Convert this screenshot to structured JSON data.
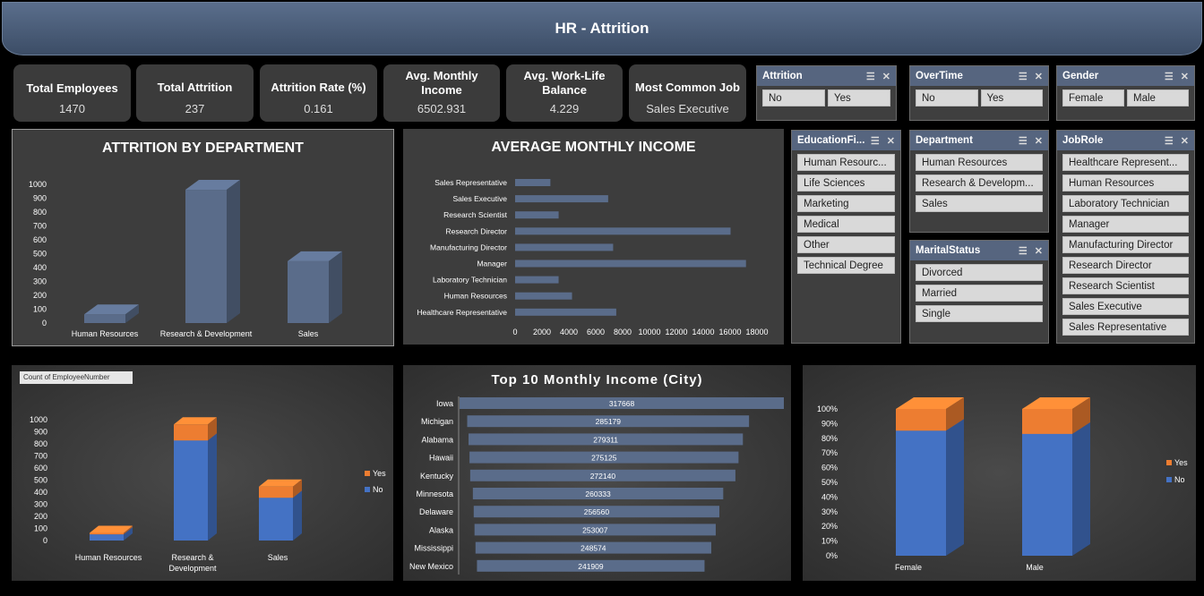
{
  "header": {
    "title": "HR - Attrition"
  },
  "kpis": [
    {
      "label": "Total Employees",
      "value": "1470"
    },
    {
      "label": "Total Attrition",
      "value": "237"
    },
    {
      "label": "Attrition Rate (%)",
      "value": "0.161"
    },
    {
      "label": "Avg. Monthly Income",
      "value": "6502.931"
    },
    {
      "label": "Avg. Work-Life Balance",
      "value": "4.229"
    },
    {
      "label": "Most Common Job",
      "value": "Sales Executive"
    }
  ],
  "slicers": {
    "attrition": {
      "title": "Attrition",
      "items": [
        "No",
        "Yes"
      ]
    },
    "overtime": {
      "title": "OverTime",
      "items": [
        "No",
        "Yes"
      ]
    },
    "gender": {
      "title": "Gender",
      "items": [
        "Female",
        "Male"
      ]
    },
    "education": {
      "title": "EducationFi...",
      "items": [
        "Human Resourc...",
        "Life Sciences",
        "Marketing",
        "Medical",
        "Other",
        "Technical Degree"
      ]
    },
    "department": {
      "title": "Department",
      "items": [
        "Human Resources",
        "Research & Developm...",
        "Sales"
      ]
    },
    "marital": {
      "title": "MaritalStatus",
      "items": [
        "Divorced",
        "Married",
        "Single"
      ]
    },
    "jobrole": {
      "title": "JobRole",
      "items": [
        "Healthcare Represent...",
        "Human Resources",
        "Laboratory Technician",
        "Manager",
        "Manufacturing Director",
        "Research Director",
        "Research Scientist",
        "Sales Executive",
        "Sales Representative"
      ]
    }
  },
  "chart_data": [
    {
      "type": "bar",
      "title": "ATTRITION BY DEPARTMENT",
      "categories": [
        "Human Resources",
        "Research & Development",
        "Sales"
      ],
      "values": [
        63,
        961,
        446
      ],
      "ylim": [
        0,
        1000
      ],
      "yticks": [
        "0",
        "100",
        "200",
        "300",
        "400",
        "500",
        "600",
        "700",
        "800",
        "900",
        "1000"
      ]
    },
    {
      "type": "bar",
      "title": "AVERAGE MONTHLY INCOME",
      "orientation": "horizontal",
      "categories": [
        "Sales Representative",
        "Sales Executive",
        "Research Scientist",
        "Research Director",
        "Manufacturing Director",
        "Manager",
        "Laboratory Technician",
        "Human Resources",
        "Healthcare Representative"
      ],
      "values": [
        2626,
        6924,
        3240,
        16034,
        7295,
        17182,
        3237,
        4236,
        7528
      ],
      "xlim": [
        0,
        18000
      ],
      "xticks": [
        "0",
        "2000",
        "4000",
        "6000",
        "8000",
        "10000",
        "12000",
        "14000",
        "16000",
        "18000"
      ]
    },
    {
      "type": "bar",
      "stacked": true,
      "field_button": "Count of EmployeeNumber",
      "categories": [
        "Human Resources",
        "Research & Development",
        "Sales"
      ],
      "series": [
        {
          "name": "No",
          "values": [
            51,
            828,
            354
          ],
          "color": "#4472c4"
        },
        {
          "name": "Yes",
          "values": [
            12,
            133,
            92
          ],
          "color": "#ed7d31"
        }
      ],
      "ylim": [
        0,
        1000
      ],
      "yticks": [
        "0",
        "100",
        "200",
        "300",
        "400",
        "500",
        "600",
        "700",
        "800",
        "900",
        "1000"
      ],
      "legend": "right"
    },
    {
      "type": "bar",
      "orientation": "horizontal",
      "title": "Top 10 Monthly Income (City)",
      "categories": [
        "Iowa",
        "Michigan",
        "Alabama",
        "Hawaii",
        "Kentucky",
        "Minnesota",
        "Delaware",
        "Alaska",
        "Mississippi",
        "New Mexico"
      ],
      "values": [
        317668,
        285179,
        279311,
        275125,
        272140,
        260333,
        256560,
        253007,
        248574,
        241909
      ],
      "labels": [
        "317668",
        "285179",
        "279311",
        "275125",
        "272140",
        "260333",
        "256560",
        "253007",
        "248574",
        "241909"
      ]
    },
    {
      "type": "bar",
      "stacked": true,
      "percent": true,
      "categories": [
        "Female",
        "Male"
      ],
      "series": [
        {
          "name": "No",
          "values": [
            85.2,
            83.0
          ],
          "color": "#4472c4"
        },
        {
          "name": "Yes",
          "values": [
            14.8,
            17.0
          ],
          "color": "#ed7d31"
        }
      ],
      "ylim": [
        0,
        100
      ],
      "yticks": [
        "0%",
        "10%",
        "20%",
        "30%",
        "40%",
        "50%",
        "60%",
        "70%",
        "80%",
        "90%",
        "100%"
      ],
      "legend": "right"
    }
  ]
}
